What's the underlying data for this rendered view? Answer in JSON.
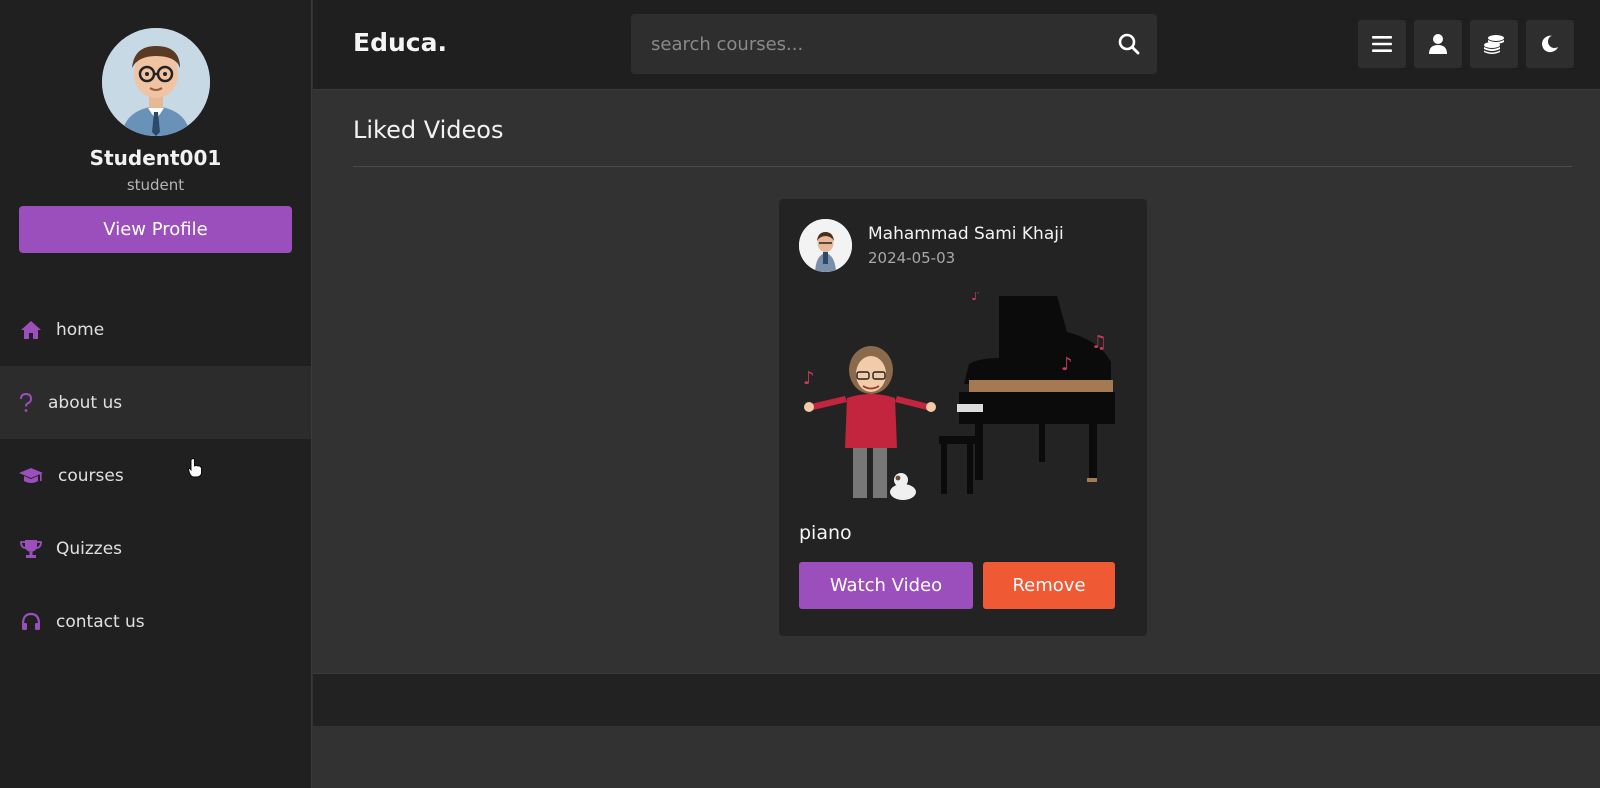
{
  "header": {
    "logo": "Educa.",
    "search_placeholder": "search courses..."
  },
  "sidebar": {
    "profile": {
      "name": "Student001",
      "role": "student",
      "view_profile_label": "View Profile"
    },
    "items": [
      {
        "label": "home",
        "icon": "home-icon"
      },
      {
        "label": "about us",
        "icon": "question-icon"
      },
      {
        "label": "courses",
        "icon": "graduation-cap-icon"
      },
      {
        "label": "Quizzes",
        "icon": "trophy-icon"
      },
      {
        "label": "contact us",
        "icon": "headset-icon"
      }
    ]
  },
  "main": {
    "title": "Liked Videos",
    "card": {
      "author": "Mahammad Sami Khaji",
      "date": "2024-05-03",
      "title": "piano",
      "watch_label": "Watch Video",
      "remove_label": "Remove"
    }
  },
  "colors": {
    "accent": "#9b4fbd",
    "danger": "#ef5a35",
    "sidebar_bg": "#202020",
    "main_bg": "#323232"
  }
}
